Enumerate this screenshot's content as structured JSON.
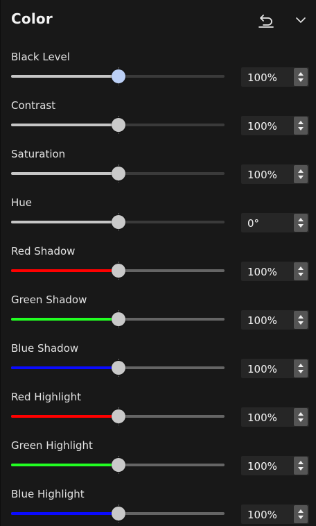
{
  "panel": {
    "title": "Color",
    "icons": {
      "reset": "undo-icon",
      "collapse": "chevron-down-icon"
    }
  },
  "colors": {
    "neutral_fill": "#c6c6c6",
    "active_thumb": "#bcd0f6",
    "red": "#ff0000",
    "green": "#22ff22",
    "blue": "#0a0aff"
  },
  "controls": [
    {
      "id": "black-level",
      "label": "Black Level",
      "value": "100%",
      "position": 0.5,
      "fill": "neutral",
      "active": true
    },
    {
      "id": "contrast",
      "label": "Contrast",
      "value": "100%",
      "position": 0.5,
      "fill": "neutral",
      "active": false
    },
    {
      "id": "saturation",
      "label": "Saturation",
      "value": "100%",
      "position": 0.5,
      "fill": "neutral",
      "active": false
    },
    {
      "id": "hue",
      "label": "Hue",
      "value": "0°",
      "position": 0.5,
      "fill": "neutral",
      "active": false
    },
    {
      "id": "red-shadow",
      "label": "Red Shadow",
      "value": "100%",
      "position": 0.5,
      "fill": "red",
      "active": false
    },
    {
      "id": "green-shadow",
      "label": "Green Shadow",
      "value": "100%",
      "position": 0.5,
      "fill": "green",
      "active": false
    },
    {
      "id": "blue-shadow",
      "label": "Blue Shadow",
      "value": "100%",
      "position": 0.5,
      "fill": "blue",
      "active": false
    },
    {
      "id": "red-highlight",
      "label": "Red Highlight",
      "value": "100%",
      "position": 0.5,
      "fill": "red",
      "active": false
    },
    {
      "id": "green-highlight",
      "label": "Green Highlight",
      "value": "100%",
      "position": 0.5,
      "fill": "green",
      "active": false
    },
    {
      "id": "blue-highlight",
      "label": "Blue Highlight",
      "value": "100%",
      "position": 0.5,
      "fill": "blue",
      "active": false
    }
  ]
}
